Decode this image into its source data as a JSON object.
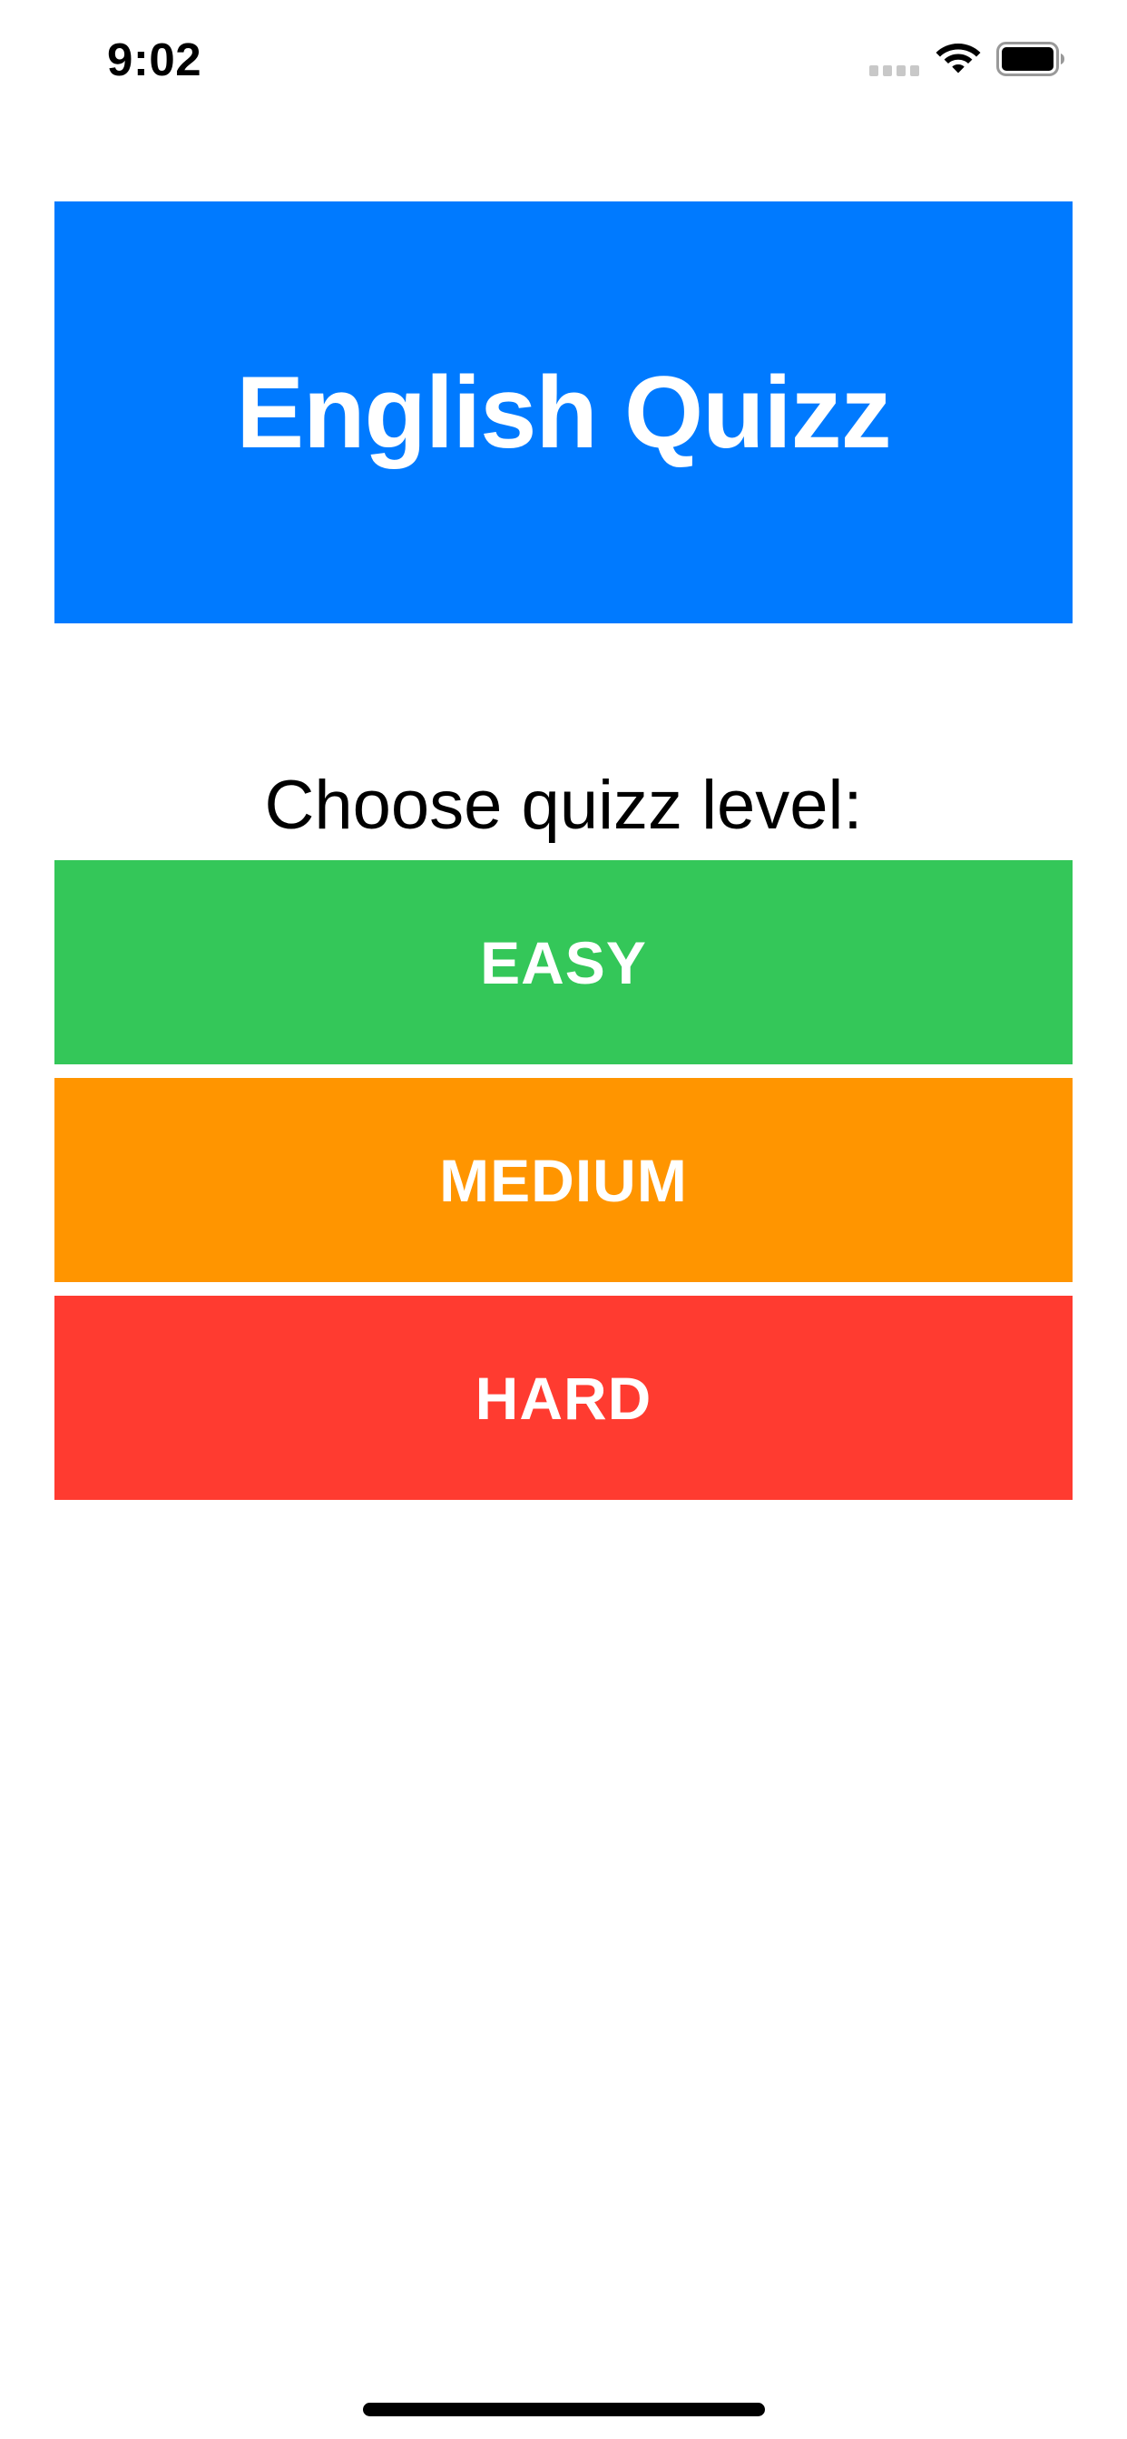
{
  "status_bar": {
    "time": "9:02"
  },
  "header": {
    "title": "English Quizz",
    "background_color": "#007AFF"
  },
  "prompt": {
    "text": "Choose quizz level:"
  },
  "levels": [
    {
      "label": "EASY",
      "color": "#34C759"
    },
    {
      "label": "MEDIUM",
      "color": "#FF9500"
    },
    {
      "label": "HARD",
      "color": "#FF3B30"
    }
  ],
  "icons": {
    "signal": "cellular-signal-icon",
    "wifi": "wifi-icon",
    "battery": "battery-icon"
  }
}
